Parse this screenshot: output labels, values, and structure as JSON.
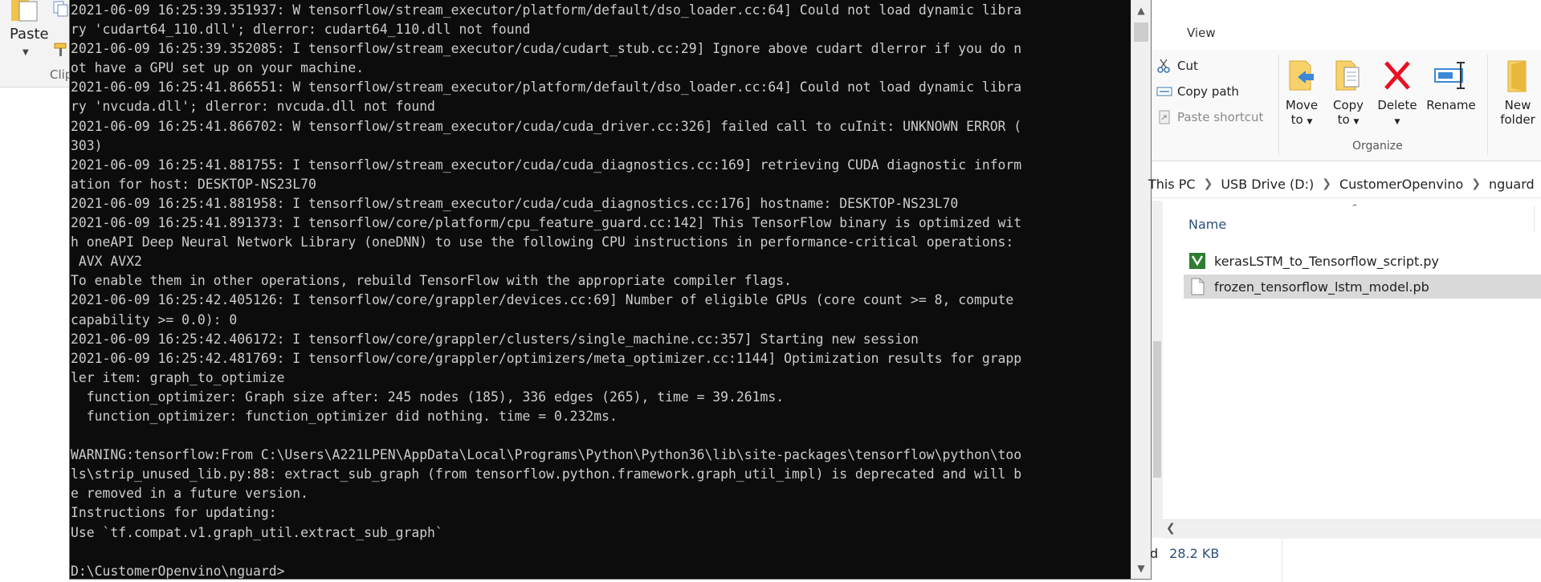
{
  "ribbon_left": {
    "paste_label": "Paste",
    "clipboard_group_label": "Clip"
  },
  "console": {
    "lines": [
      "2021-06-09 16:25:39.351937: W tensorflow/stream_executor/platform/default/dso_loader.cc:64] Could not load dynamic libra",
      "ry 'cudart64_110.dll'; dlerror: cudart64_110.dll not found",
      "2021-06-09 16:25:39.352085: I tensorflow/stream_executor/cuda/cudart_stub.cc:29] Ignore above cudart dlerror if you do n",
      "ot have a GPU set up on your machine.",
      "2021-06-09 16:25:41.866551: W tensorflow/stream_executor/platform/default/dso_loader.cc:64] Could not load dynamic libra",
      "ry 'nvcuda.dll'; dlerror: nvcuda.dll not found",
      "2021-06-09 16:25:41.866702: W tensorflow/stream_executor/cuda/cuda_driver.cc:326] failed call to cuInit: UNKNOWN ERROR (",
      "303)",
      "2021-06-09 16:25:41.881755: I tensorflow/stream_executor/cuda/cuda_diagnostics.cc:169] retrieving CUDA diagnostic inform",
      "ation for host: DESKTOP-NS23L70",
      "2021-06-09 16:25:41.881958: I tensorflow/stream_executor/cuda/cuda_diagnostics.cc:176] hostname: DESKTOP-NS23L70",
      "2021-06-09 16:25:41.891373: I tensorflow/core/platform/cpu_feature_guard.cc:142] This TensorFlow binary is optimized wit",
      "h oneAPI Deep Neural Network Library (oneDNN) to use the following CPU instructions in performance-critical operations:",
      " AVX AVX2",
      "To enable them in other operations, rebuild TensorFlow with the appropriate compiler flags.",
      "2021-06-09 16:25:42.405126: I tensorflow/core/grappler/devices.cc:69] Number of eligible GPUs (core count >= 8, compute",
      "capability >= 0.0): 0",
      "2021-06-09 16:25:42.406172: I tensorflow/core/grappler/clusters/single_machine.cc:357] Starting new session",
      "2021-06-09 16:25:42.481769: I tensorflow/core/grappler/optimizers/meta_optimizer.cc:1144] Optimization results for grapp",
      "ler item: graph_to_optimize",
      "  function_optimizer: Graph size after: 245 nodes (185), 336 edges (265), time = 39.261ms.",
      "  function_optimizer: function_optimizer did nothing. time = 0.232ms.",
      "",
      "WARNING:tensorflow:From C:\\Users\\A221LPEN\\AppData\\Local\\Programs\\Python\\Python36\\lib\\site-packages\\tensorflow\\python\\too",
      "ls\\strip_unused_lib.py:88: extract_sub_graph (from tensorflow.python.framework.graph_util_impl) is deprecated and will b",
      "e removed in a future version.",
      "Instructions for updating:",
      "Use `tf.compat.v1.graph_util.extract_sub_graph`",
      "",
      "D:\\CustomerOpenvino\\nguard>"
    ]
  },
  "explorer": {
    "view_tab": "View",
    "ribbon": {
      "cut": "Cut",
      "copy_path": "Copy path",
      "paste_shortcut": "Paste shortcut",
      "move_to": "Move",
      "move_to_2": "to",
      "copy_to": "Copy",
      "copy_to_2": "to",
      "delete": "Delete",
      "rename": "Rename",
      "new_folder": "New",
      "new_folder_2": "folder",
      "organize_group": "Organize"
    },
    "breadcrumb": [
      "This PC",
      "USB Drive (D:)",
      "CustomerOpenvino",
      "nguard"
    ],
    "column_name": "Name",
    "files": [
      {
        "name": "kerasLSTM_to_Tensorflow_script.py",
        "icon": "python-file-icon",
        "selected": false
      },
      {
        "name": "frozen_tensorflow_lstm_model.pb",
        "icon": "blank-file-icon",
        "selected": true
      }
    ],
    "status": {
      "size": "28.2 KB",
      "prefix": "d"
    }
  },
  "colors": {
    "console_bg": "#0c0c0c",
    "console_fg": "#cccccc",
    "selection": "#d9d9d9",
    "delete_red": "#e81123",
    "accent_blue": "#2a4f7a"
  }
}
